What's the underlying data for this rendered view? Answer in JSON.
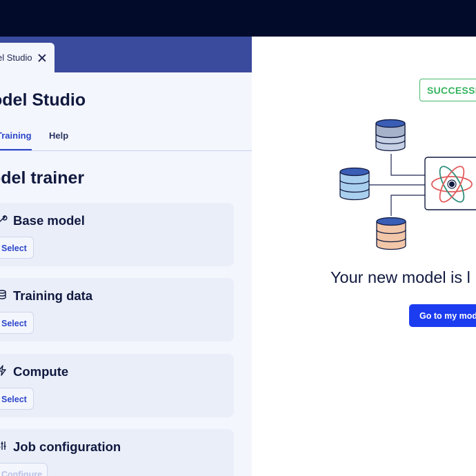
{
  "window": {
    "tab_label": "el Studio"
  },
  "app": {
    "title": "odel Studio",
    "nav_tabs": [
      {
        "label": "Training",
        "active": true
      },
      {
        "label": "Help",
        "active": false
      }
    ]
  },
  "trainer": {
    "heading": "odel trainer",
    "cards": [
      {
        "title": "Base model",
        "icon": "wrench-icon",
        "button": "Select",
        "enabled": true
      },
      {
        "title": "Training data",
        "icon": "database-icon",
        "button": "Select",
        "enabled": true
      },
      {
        "title": "Compute",
        "icon": "lightning-icon",
        "button": "Select",
        "enabled": true
      },
      {
        "title": "Job configuration",
        "icon": "sliders-icon",
        "button": "Configure",
        "enabled": false
      }
    ]
  },
  "result": {
    "badge": "SUCCESSF",
    "message": "Your new model is l",
    "cta_label": "Go to my mode"
  },
  "colors": {
    "top_bar": "#020b2a",
    "tab_bar": "#3a4a9c",
    "accent": "#2b47c9",
    "success": "#35b35d",
    "cta": "#1c3cf0"
  }
}
